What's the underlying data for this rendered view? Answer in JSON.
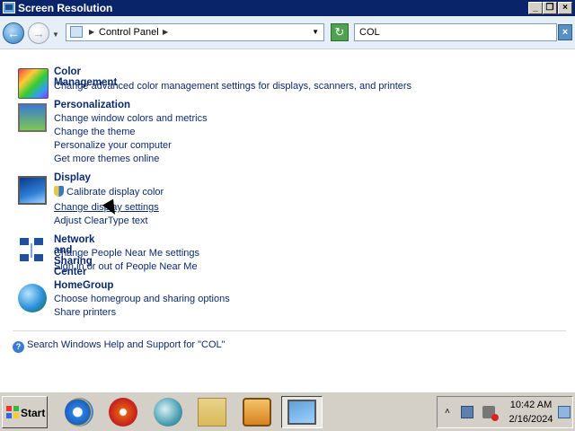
{
  "window": {
    "title": "Screen Resolution",
    "minimize_glyph": "_",
    "maximize_glyph": "❐",
    "close_glyph": "×"
  },
  "addressbar": {
    "breadcrumb": "Control Panel",
    "search_value": "COL"
  },
  "groups": [
    {
      "title": "Color Management",
      "icon": "color-management-icon",
      "tasks": [
        "Change advanced color management settings for displays, scanners, and printers"
      ]
    },
    {
      "title": "Personalization",
      "icon": "personalization-icon",
      "tasks": [
        "Change window colors and metrics",
        "Change the theme",
        "Personalize your computer",
        "Get more themes online"
      ]
    },
    {
      "title": "Display",
      "icon": "display-icon",
      "tasks": [
        "Calibrate display color",
        "Change display settings",
        "Adjust ClearType text"
      ]
    },
    {
      "title": "Network and Sharing Center",
      "icon": "network-icon",
      "tasks": [
        "Change People Near Me settings",
        "Sign in or out of People Near Me"
      ]
    },
    {
      "title": "HomeGroup",
      "icon": "homegroup-icon",
      "tasks": [
        "Choose homegroup and sharing options",
        "Share printers"
      ]
    }
  ],
  "help_link": "Search Windows Help and Support for \"COL\"",
  "taskbar": {
    "start_label": "Start",
    "quicklaunch": [
      "internet-explorer-icon",
      "media-player-icon",
      "globe-icon",
      "folder-icon",
      "player-icon"
    ],
    "tray": {
      "time": "10:42 AM",
      "date": "2/16/2024"
    }
  }
}
